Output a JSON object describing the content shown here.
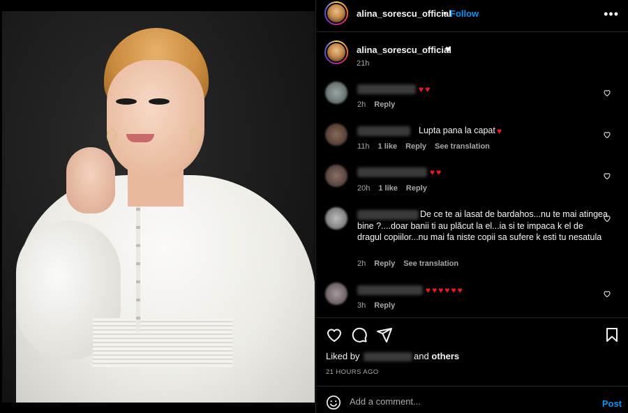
{
  "post": {
    "username": "alina_sorescu_official",
    "follow_label": "Follow",
    "dot": "•",
    "more_label": "•••",
    "caption_heart": "♥",
    "caption_time": "21h"
  },
  "comments": [
    {
      "text": "",
      "hearts": "♥♥",
      "time": "2h",
      "likes": "",
      "reply": "Reply",
      "translate": ""
    },
    {
      "text": "Lupta pana la capat",
      "hearts": "♥",
      "time": "11h",
      "likes": "1 like",
      "reply": "Reply",
      "translate": "See translation"
    },
    {
      "text": "",
      "hearts": "♥♥",
      "time": "20h",
      "likes": "1 like",
      "reply": "Reply",
      "translate": ""
    },
    {
      "text": "De ce te ai lasat de bardahos...nu te mai atingea bine ?....doar banii ti au plăcut la el...ia si te impaca k el de dragul copiilor...nu mai fa niste copii sa sufere k esti tu nesatula",
      "hearts": "",
      "time": "2h",
      "likes": "",
      "reply": "Reply",
      "translate": "See translation"
    },
    {
      "text": "",
      "hearts": "♥♥♥♥♥♥",
      "time": "3h",
      "likes": "",
      "reply": "Reply",
      "translate": ""
    }
  ],
  "likes": {
    "prefix": "Liked by",
    "suffix_and": "and",
    "suffix_others": "others"
  },
  "post_time": "21 HOURS AGO",
  "add_comment": {
    "placeholder": "Add a comment...",
    "post_label": "Post"
  },
  "colors": {
    "accent": "#0095f6",
    "heart_red": "#ed1c24",
    "muted": "#a8a8a8"
  },
  "icons": [
    "like-icon",
    "comment-icon",
    "share-icon",
    "save-icon",
    "emoji-icon",
    "more-icon"
  ]
}
